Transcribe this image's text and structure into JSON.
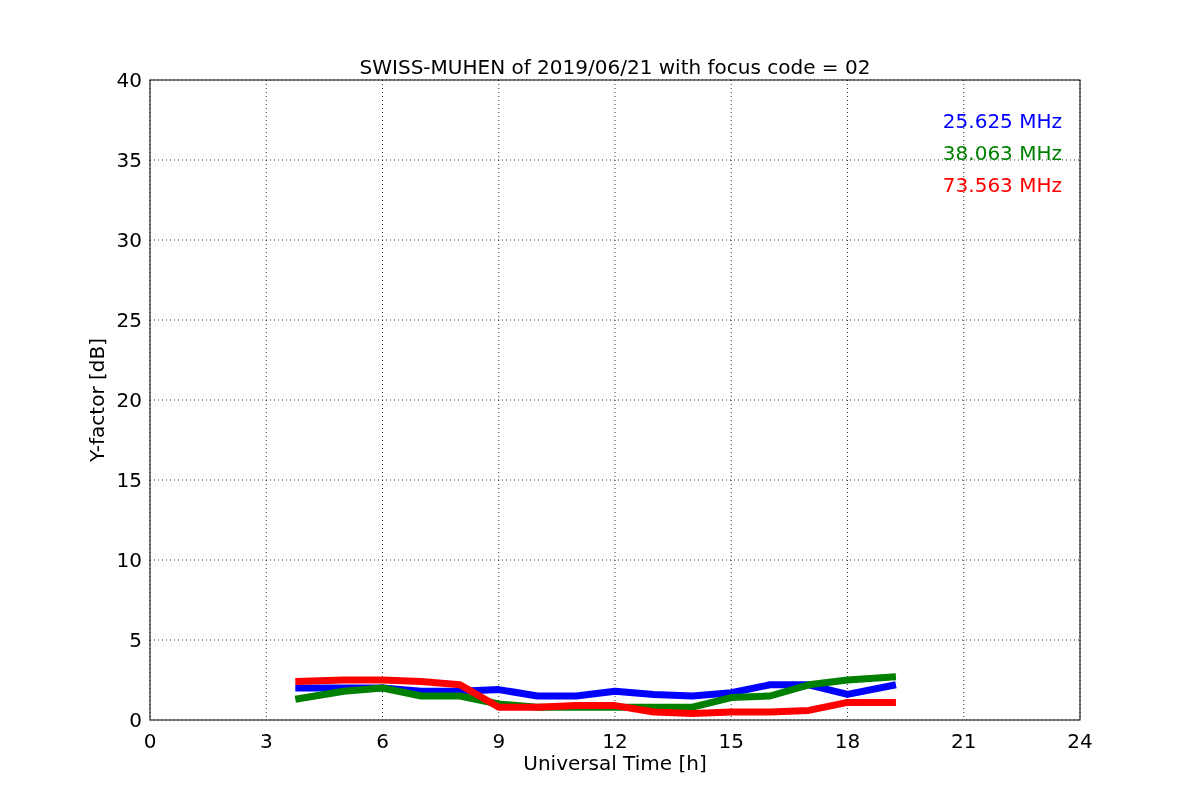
{
  "figure": {
    "chart_data": {
      "type": "line",
      "title": "SWISS-MUHEN of 2019/06/21 with focus code = 02",
      "xlabel": "Universal Time [h]",
      "ylabel": "Y-factor [dB]",
      "x": [
        3.75,
        5,
        6,
        7,
        8,
        9,
        10,
        11,
        12,
        13,
        14,
        15,
        16,
        17,
        18,
        19.25
      ],
      "series": [
        {
          "name": "25.625 MHz",
          "color": "#0000ff",
          "values": [
            2.0,
            2.0,
            2.0,
            1.8,
            1.8,
            1.9,
            1.5,
            1.5,
            1.8,
            1.6,
            1.5,
            1.7,
            2.2,
            2.2,
            1.6,
            2.2
          ]
        },
        {
          "name": "38.063 MHz",
          "color": "#008000",
          "values": [
            1.3,
            1.8,
            2.0,
            1.5,
            1.5,
            1.0,
            0.8,
            0.8,
            0.8,
            0.8,
            0.8,
            1.4,
            1.5,
            2.2,
            2.5,
            2.7
          ]
        },
        {
          "name": "73.563 MHz",
          "color": "#ff0000",
          "values": [
            2.4,
            2.5,
            2.5,
            2.4,
            2.2,
            0.8,
            0.8,
            0.9,
            0.9,
            0.5,
            0.4,
            0.5,
            0.5,
            0.6,
            1.1,
            1.1
          ]
        }
      ],
      "grid": true,
      "xlim": [
        0,
        24
      ],
      "ylim": [
        0,
        40
      ],
      "xticks": [
        0,
        3,
        6,
        9,
        12,
        15,
        18,
        21,
        24
      ],
      "yticks": [
        0,
        5,
        10,
        15,
        20,
        25,
        30,
        35,
        40
      ]
    }
  }
}
